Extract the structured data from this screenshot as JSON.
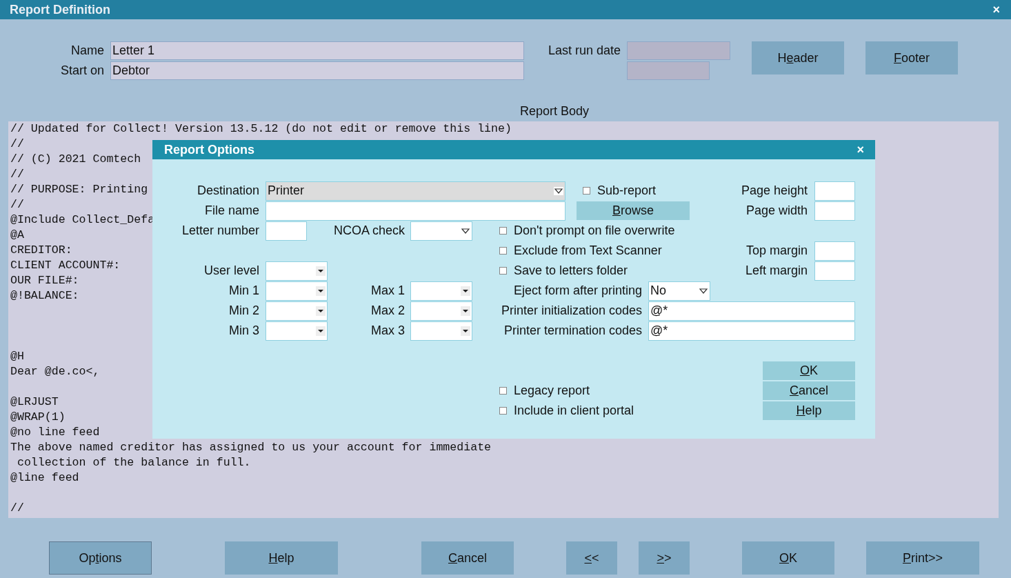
{
  "window": {
    "title": "Report Definition",
    "close": "×"
  },
  "name_field": {
    "label": "Name",
    "value": "Letter 1"
  },
  "start_on_field": {
    "label": "Start on",
    "value": "Debtor"
  },
  "last_run_date": {
    "label": "Last run date"
  },
  "top_buttons": [
    {
      "parts": [
        {
          "text": "H"
        },
        {
          "text": "e",
          "underline": true
        },
        {
          "text": "ader"
        }
      ]
    },
    {
      "parts": [
        {
          "text": "F",
          "underline": true
        },
        {
          "text": "ooter"
        }
      ]
    }
  ],
  "report_body": {
    "label": "Report Body",
    "lines": [
      {
        "kind": "text",
        "text": "// Updated for Collect! Version 13.5.12 (do not edit or remove this line)"
      },
      {
        "kind": "text",
        "text": "//"
      },
      {
        "kind": "text",
        "text": "// (C) 2021 Comtech"
      },
      {
        "kind": "text",
        "text": "//"
      },
      {
        "kind": "text",
        "text": "// PURPOSE: Printing"
      },
      {
        "kind": "text",
        "text": "//"
      },
      {
        "kind": "text",
        "text": "@Include Collect_Defa"
      },
      {
        "kind": "text",
        "text": "@A"
      },
      {
        "kind": "text",
        "text": "CREDITOR:"
      },
      {
        "kind": "text",
        "text": "CLIENT ACCOUNT#:"
      },
      {
        "kind": "text",
        "text": "OUR FILE#:"
      },
      {
        "kind": "text",
        "text": "@!BALANCE:"
      },
      {
        "kind": "blank"
      },
      {
        "kind": "blank"
      },
      {
        "kind": "blank"
      },
      {
        "kind": "text",
        "text": "@H"
      },
      {
        "kind": "text",
        "text": "Dear @de.co<,"
      },
      {
        "kind": "blank"
      },
      {
        "kind": "text",
        "text": "@LRJUST"
      },
      {
        "kind": "text",
        "text": "@WRAP(1)"
      },
      {
        "kind": "text",
        "text": "@no line feed"
      },
      {
        "kind": "text",
        "text": "The above named creditor has assigned to us your account for immediate"
      },
      {
        "kind": "text",
        "text": " collection of the balance in full."
      },
      {
        "kind": "text",
        "text": "@line feed"
      },
      {
        "kind": "blank"
      },
      {
        "kind": "text",
        "text": "//"
      }
    ]
  },
  "bottom_buttons": [
    {
      "focused": true,
      "parts": [
        {
          "text": "Op"
        },
        {
          "text": "t",
          "underline": true
        },
        {
          "text": "ions"
        }
      ]
    },
    {
      "focused": false,
      "parts": [
        {
          "text": "H",
          "underline": true
        },
        {
          "text": "elp"
        }
      ]
    },
    {
      "focused": false,
      "parts": [
        {
          "text": "C",
          "underline": true
        },
        {
          "text": "ancel"
        }
      ]
    },
    {
      "focused": false,
      "parts": [
        {
          "text": "<",
          "underline": true
        },
        {
          "text": "<"
        }
      ]
    },
    {
      "focused": false,
      "parts": [
        {
          "text": ">",
          "underline": true
        },
        {
          "text": ">"
        }
      ]
    },
    {
      "focused": false,
      "parts": [
        {
          "text": "O",
          "underline": true
        },
        {
          "text": "K"
        }
      ]
    },
    {
      "focused": false,
      "parts": [
        {
          "text": "P",
          "underline": true
        },
        {
          "text": "rint>>"
        }
      ]
    }
  ],
  "dialog": {
    "title": "Report Options",
    "close": "×",
    "destination": {
      "label": "Destination",
      "value": "Printer",
      "readonly": true
    },
    "sub_report": {
      "label": "Sub-report",
      "checked": false
    },
    "page_height": {
      "label": "Page height"
    },
    "file_name": {
      "label": "File name"
    },
    "browse_button": {
      "parts": [
        {
          "text": "B",
          "underline": true
        },
        {
          "text": "rowse"
        }
      ]
    },
    "page_width": {
      "label": "Page width"
    },
    "letter_number": {
      "label": "Letter number"
    },
    "ncoa_check": {
      "label": "NCOA check"
    },
    "options": [
      {
        "label": "Don't prompt on file overwrite",
        "checked": false
      },
      {
        "label": "Exclude from Text Scanner",
        "checked": false
      },
      {
        "label": "Save to letters folder",
        "checked": false
      }
    ],
    "top_margin": {
      "label": "Top margin"
    },
    "left_margin": {
      "label": "Left margin"
    },
    "user_level": {
      "label": "User level"
    },
    "ranges": [
      {
        "min_label": "Min 1",
        "max_label": "Max 1"
      },
      {
        "min_label": "Min 2",
        "max_label": "Max 2"
      },
      {
        "min_label": "Min 3",
        "max_label": "Max 3"
      }
    ],
    "eject_form": {
      "label": "Eject form after printing",
      "value": "No"
    },
    "init_codes": {
      "label": "Printer initialization codes",
      "value": "@*"
    },
    "term_codes": {
      "label": "Printer termination codes",
      "value": "@*"
    },
    "flags": [
      {
        "label": "Legacy report",
        "checked": false
      },
      {
        "label": "Include in client portal",
        "checked": false
      }
    ],
    "buttons": [
      {
        "parts": [
          {
            "text": "O",
            "underline": true
          },
          {
            "text": "K"
          }
        ]
      },
      {
        "parts": [
          {
            "text": "C",
            "underline": true
          },
          {
            "text": "ancel"
          }
        ]
      },
      {
        "parts": [
          {
            "text": "H",
            "underline": true
          },
          {
            "text": "elp"
          }
        ]
      }
    ]
  }
}
